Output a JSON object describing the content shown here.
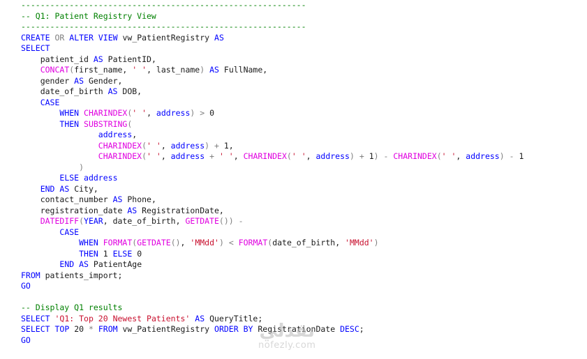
{
  "colors": {
    "comment": "#008000",
    "keyword": "#0000ff",
    "function": "#e000e0",
    "string": "#c8102e",
    "operator": "#808080",
    "text": "#1a1a1a",
    "background": "#ffffff"
  },
  "editor": {
    "lines": [
      [
        [
          "comment",
          "-----------------------------------------------------------"
        ]
      ],
      [
        [
          "comment",
          "-- Q1: Patient Registry View"
        ]
      ],
      [
        [
          "comment",
          "-----------------------------------------------------------"
        ]
      ],
      [
        [
          "keyword",
          "CREATE"
        ],
        [
          "text",
          " "
        ],
        [
          "operator",
          "OR"
        ],
        [
          "text",
          " "
        ],
        [
          "keyword",
          "ALTER"
        ],
        [
          "text",
          " "
        ],
        [
          "keyword",
          "VIEW"
        ],
        [
          "text",
          " vw_PatientRegistry "
        ],
        [
          "keyword",
          "AS"
        ]
      ],
      [
        [
          "keyword",
          "SELECT"
        ]
      ],
      [
        [
          "text",
          "    patient_id "
        ],
        [
          "keyword",
          "AS"
        ],
        [
          "text",
          " PatientID,"
        ]
      ],
      [
        [
          "text",
          "    "
        ],
        [
          "function",
          "CONCAT"
        ],
        [
          "operator",
          "("
        ],
        [
          "text",
          "first_name, "
        ],
        [
          "string",
          "' '"
        ],
        [
          "text",
          ", last_name"
        ],
        [
          "operator",
          ")"
        ],
        [
          "text",
          " "
        ],
        [
          "keyword",
          "AS"
        ],
        [
          "text",
          " FullName,"
        ]
      ],
      [
        [
          "text",
          "    gender "
        ],
        [
          "keyword",
          "AS"
        ],
        [
          "text",
          " Gender,"
        ]
      ],
      [
        [
          "text",
          "    date_of_birth "
        ],
        [
          "keyword",
          "AS"
        ],
        [
          "text",
          " DOB,"
        ]
      ],
      [
        [
          "text",
          "    "
        ],
        [
          "keyword",
          "CASE"
        ]
      ],
      [
        [
          "text",
          "        "
        ],
        [
          "keyword",
          "WHEN"
        ],
        [
          "text",
          " "
        ],
        [
          "function",
          "CHARINDEX"
        ],
        [
          "operator",
          "("
        ],
        [
          "string",
          "' '"
        ],
        [
          "text",
          ", "
        ],
        [
          "keyword",
          "address"
        ],
        [
          "operator",
          ")"
        ],
        [
          "text",
          " "
        ],
        [
          "operator",
          ">"
        ],
        [
          "text",
          " 0"
        ]
      ],
      [
        [
          "text",
          "        "
        ],
        [
          "keyword",
          "THEN"
        ],
        [
          "text",
          " "
        ],
        [
          "function",
          "SUBSTRING"
        ],
        [
          "operator",
          "("
        ]
      ],
      [
        [
          "text",
          "                "
        ],
        [
          "keyword",
          "address"
        ],
        [
          "text",
          ","
        ]
      ],
      [
        [
          "text",
          "                "
        ],
        [
          "function",
          "CHARINDEX"
        ],
        [
          "operator",
          "("
        ],
        [
          "string",
          "' '"
        ],
        [
          "text",
          ", "
        ],
        [
          "keyword",
          "address"
        ],
        [
          "operator",
          ")"
        ],
        [
          "text",
          " "
        ],
        [
          "operator",
          "+"
        ],
        [
          "text",
          " 1,"
        ]
      ],
      [
        [
          "text",
          "                "
        ],
        [
          "function",
          "CHARINDEX"
        ],
        [
          "operator",
          "("
        ],
        [
          "string",
          "' '"
        ],
        [
          "text",
          ", "
        ],
        [
          "keyword",
          "address"
        ],
        [
          "text",
          " "
        ],
        [
          "operator",
          "+"
        ],
        [
          "text",
          " "
        ],
        [
          "string",
          "' '"
        ],
        [
          "text",
          ", "
        ],
        [
          "function",
          "CHARINDEX"
        ],
        [
          "operator",
          "("
        ],
        [
          "string",
          "' '"
        ],
        [
          "text",
          ", "
        ],
        [
          "keyword",
          "address"
        ],
        [
          "operator",
          ")"
        ],
        [
          "text",
          " "
        ],
        [
          "operator",
          "+"
        ],
        [
          "text",
          " 1"
        ],
        [
          "operator",
          ")"
        ],
        [
          "text",
          " "
        ],
        [
          "operator",
          "-"
        ],
        [
          "text",
          " "
        ],
        [
          "function",
          "CHARINDEX"
        ],
        [
          "operator",
          "("
        ],
        [
          "string",
          "' '"
        ],
        [
          "text",
          ", "
        ],
        [
          "keyword",
          "address"
        ],
        [
          "operator",
          ")"
        ],
        [
          "text",
          " "
        ],
        [
          "operator",
          "-"
        ],
        [
          "text",
          " 1"
        ]
      ],
      [
        [
          "text",
          "            "
        ],
        [
          "operator",
          ")"
        ]
      ],
      [
        [
          "text",
          "        "
        ],
        [
          "keyword",
          "ELSE"
        ],
        [
          "text",
          " "
        ],
        [
          "keyword",
          "address"
        ]
      ],
      [
        [
          "text",
          "    "
        ],
        [
          "keyword",
          "END"
        ],
        [
          "text",
          " "
        ],
        [
          "keyword",
          "AS"
        ],
        [
          "text",
          " City,"
        ]
      ],
      [
        [
          "text",
          "    contact_number "
        ],
        [
          "keyword",
          "AS"
        ],
        [
          "text",
          " Phone,"
        ]
      ],
      [
        [
          "text",
          "    registration_date "
        ],
        [
          "keyword",
          "AS"
        ],
        [
          "text",
          " RegistrationDate,"
        ]
      ],
      [
        [
          "text",
          "    "
        ],
        [
          "function",
          "DATEDIFF"
        ],
        [
          "operator",
          "("
        ],
        [
          "keyword",
          "YEAR"
        ],
        [
          "text",
          ", date_of_birth, "
        ],
        [
          "function",
          "GETDATE"
        ],
        [
          "operator",
          "())"
        ],
        [
          "text",
          " "
        ],
        [
          "operator",
          "-"
        ]
      ],
      [
        [
          "text",
          "        "
        ],
        [
          "keyword",
          "CASE"
        ]
      ],
      [
        [
          "text",
          "            "
        ],
        [
          "keyword",
          "WHEN"
        ],
        [
          "text",
          " "
        ],
        [
          "function",
          "FORMAT"
        ],
        [
          "operator",
          "("
        ],
        [
          "function",
          "GETDATE"
        ],
        [
          "operator",
          "()"
        ],
        [
          "text",
          ", "
        ],
        [
          "string",
          "'MMdd'"
        ],
        [
          "operator",
          ")"
        ],
        [
          "text",
          " "
        ],
        [
          "operator",
          "<"
        ],
        [
          "text",
          " "
        ],
        [
          "function",
          "FORMAT"
        ],
        [
          "operator",
          "("
        ],
        [
          "text",
          "date_of_birth, "
        ],
        [
          "string",
          "'MMdd'"
        ],
        [
          "operator",
          ")"
        ]
      ],
      [
        [
          "text",
          "            "
        ],
        [
          "keyword",
          "THEN"
        ],
        [
          "text",
          " 1 "
        ],
        [
          "keyword",
          "ELSE"
        ],
        [
          "text",
          " 0"
        ]
      ],
      [
        [
          "text",
          "        "
        ],
        [
          "keyword",
          "END"
        ],
        [
          "text",
          " "
        ],
        [
          "keyword",
          "AS"
        ],
        [
          "text",
          " PatientAge"
        ]
      ],
      [
        [
          "keyword",
          "FROM"
        ],
        [
          "text",
          " patients_import;"
        ]
      ],
      [
        [
          "keyword",
          "GO"
        ]
      ],
      [
        [
          "text",
          ""
        ]
      ],
      [
        [
          "comment",
          "-- Display Q1 results"
        ]
      ],
      [
        [
          "keyword",
          "SELECT"
        ],
        [
          "text",
          " "
        ],
        [
          "string",
          "'Q1: Top 20 Newest Patients'"
        ],
        [
          "text",
          " "
        ],
        [
          "keyword",
          "AS"
        ],
        [
          "text",
          " QueryTitle;"
        ]
      ],
      [
        [
          "keyword",
          "SELECT"
        ],
        [
          "text",
          " "
        ],
        [
          "keyword",
          "TOP"
        ],
        [
          "text",
          " 20 "
        ],
        [
          "operator",
          "*"
        ],
        [
          "text",
          " "
        ],
        [
          "keyword",
          "FROM"
        ],
        [
          "text",
          " vw_PatientRegistry "
        ],
        [
          "keyword",
          "ORDER"
        ],
        [
          "text",
          " "
        ],
        [
          "keyword",
          "BY"
        ],
        [
          "text",
          " RegistrationDate "
        ],
        [
          "keyword",
          "DESC"
        ],
        [
          "text",
          ";"
        ]
      ],
      [
        [
          "keyword",
          "GO"
        ]
      ]
    ]
  },
  "watermark": {
    "arabic": "نفذلي",
    "latin": "nofezly.com"
  }
}
